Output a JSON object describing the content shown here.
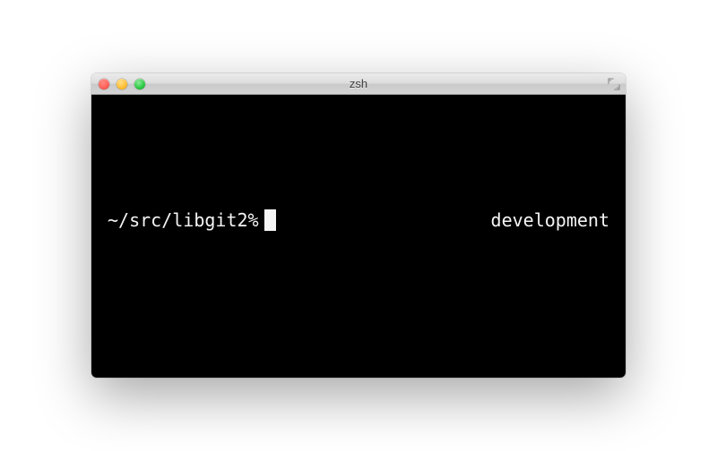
{
  "window": {
    "title": "zsh"
  },
  "terminal": {
    "prompt": "~/src/libgit2%",
    "rprompt": "development"
  }
}
